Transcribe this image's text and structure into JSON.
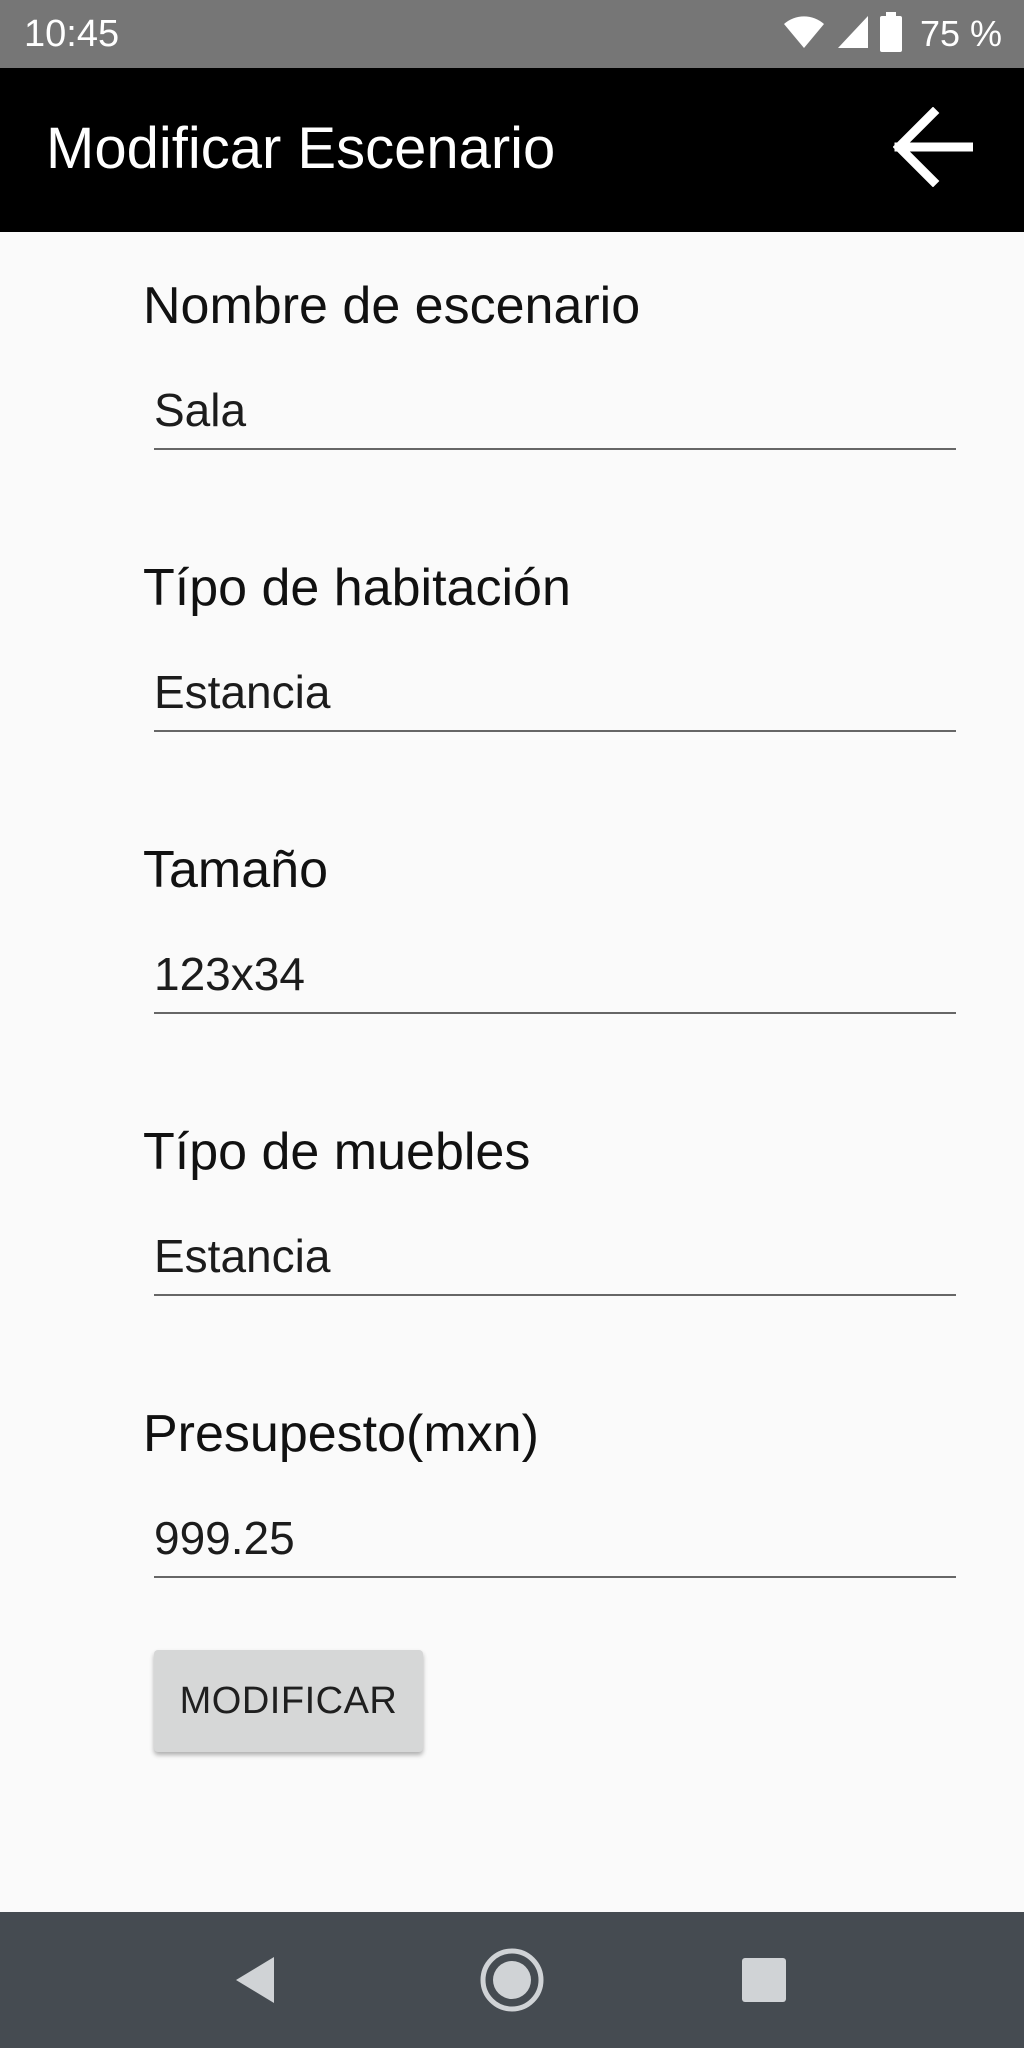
{
  "status_bar": {
    "time": "10:45",
    "battery_percent": "75 %",
    "icons": [
      "wifi-icon",
      "signal-icon",
      "battery-icon"
    ]
  },
  "app_bar": {
    "title": "Modificar Escenario",
    "back_icon": "arrow-back-icon",
    "background": "#000000"
  },
  "form": {
    "fields": [
      {
        "label": "Nombre de escenario",
        "value": "Sala"
      },
      {
        "label": "Típo de habitación",
        "value": "Estancia"
      },
      {
        "label": "Tamaño",
        "value": "123x34"
      },
      {
        "label": "Típo de muebles",
        "value": "Estancia"
      },
      {
        "label": "Presupesto(mxn)",
        "value": "999.25"
      }
    ],
    "submit_label": "MODIFICAR"
  },
  "nav_bar": {
    "icons": [
      "back-triangle-icon",
      "home-circle-icon",
      "recents-square-icon"
    ],
    "background": "#454b51"
  }
}
